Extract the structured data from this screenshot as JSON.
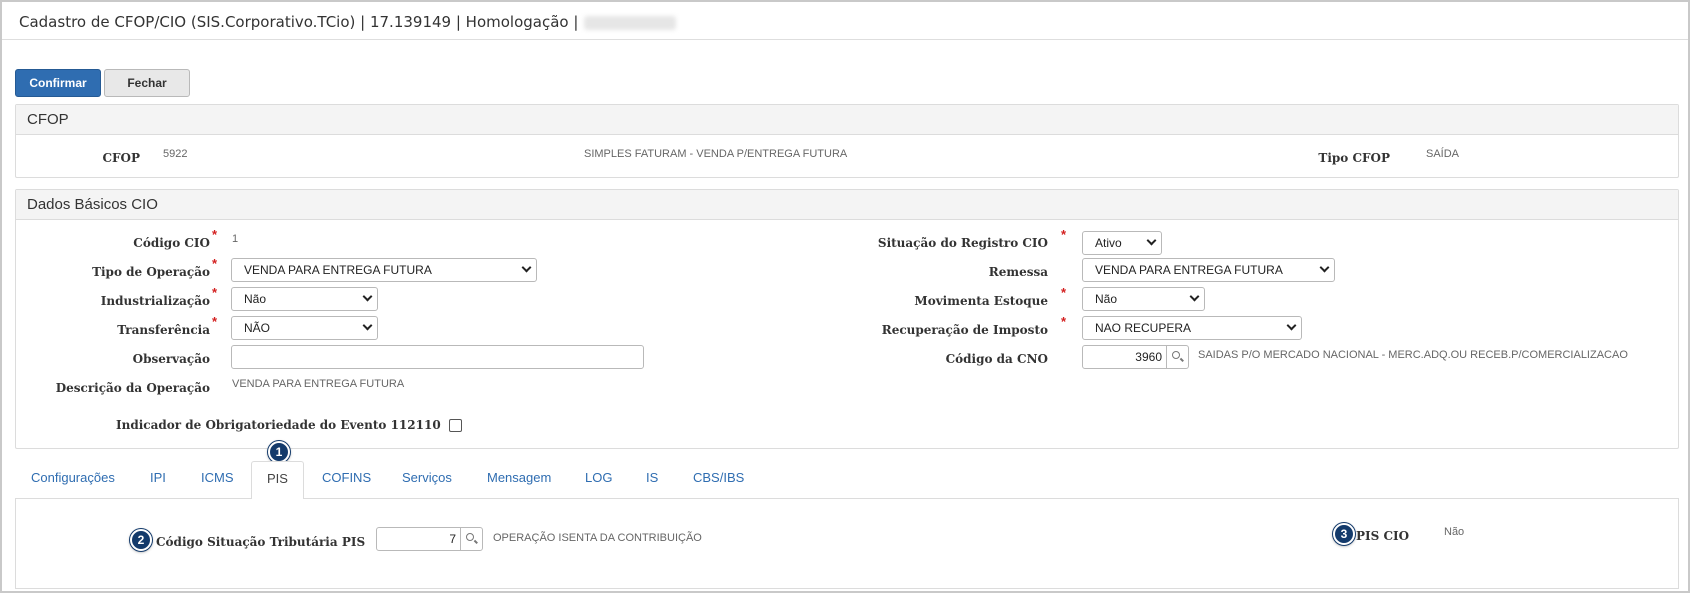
{
  "title": {
    "text": "Cadastro de CFOP/CIO (SIS.Corporativo.TCio) | 17.139149 | Homologação |"
  },
  "toolbar": {
    "confirm_label": "Confirmar",
    "close_label": "Fechar"
  },
  "cfop_panel": {
    "heading": "CFOP",
    "cfop_label": "CFOP",
    "cfop_value": "5922",
    "cfop_description": "SIMPLES FATURAM - VENDA P/ENTREGA FUTURA",
    "tipo_label": "Tipo CFOP",
    "tipo_value": "SAÍDA"
  },
  "cio_panel": {
    "heading": "Dados Básicos CIO",
    "required_mark": "*",
    "codigo_cio_label": "Código CIO",
    "codigo_cio_value": "1",
    "tipo_operacao_label": "Tipo de Operação",
    "tipo_operacao_value": "VENDA PARA ENTREGA FUTURA",
    "industrializacao_label": "Industrialização",
    "industrializacao_value": "Não",
    "transferencia_label": "Transferência",
    "transferencia_value": "NÃO",
    "observacao_label": "Observação",
    "observacao_value": "",
    "descricao_label": "Descrição da Operação",
    "descricao_value": "VENDA PARA ENTREGA FUTURA",
    "indicador_label": "Indicador de Obrigatoriedade do Evento 112110",
    "situacao_label": "Situação do Registro CIO",
    "situacao_value": "Ativo",
    "remessa_label": "Remessa",
    "remessa_value": "VENDA PARA ENTREGA FUTURA",
    "movimenta_label": "Movimenta Estoque",
    "movimenta_value": "Não",
    "recuperacao_label": "Recuperação de Imposto",
    "recuperacao_value": "NAO RECUPERA",
    "cno_label": "Código da CNO",
    "cno_value": "3960",
    "cno_description": "SAIDAS P/O MERCADO NACIONAL - MERC.ADQ.OU RECEB.P/COMERCIALIZACAO"
  },
  "tabs": [
    {
      "label": "Configurações"
    },
    {
      "label": "IPI"
    },
    {
      "label": "ICMS"
    },
    {
      "label": "PIS"
    },
    {
      "label": "COFINS"
    },
    {
      "label": "Serviços"
    },
    {
      "label": "Mensagem"
    },
    {
      "label": "LOG"
    },
    {
      "label": "IS"
    },
    {
      "label": "CBS/IBS"
    }
  ],
  "pis_tab": {
    "cst_label": "Código Situação Tributária PIS",
    "cst_value": "7",
    "cst_description": "OPERAÇÃO ISENTA DA CONTRIBUIÇÃO",
    "pis_cio_label": "PIS CIO",
    "pis_cio_value": "Não"
  },
  "badges": [
    "1",
    "2",
    "3"
  ]
}
